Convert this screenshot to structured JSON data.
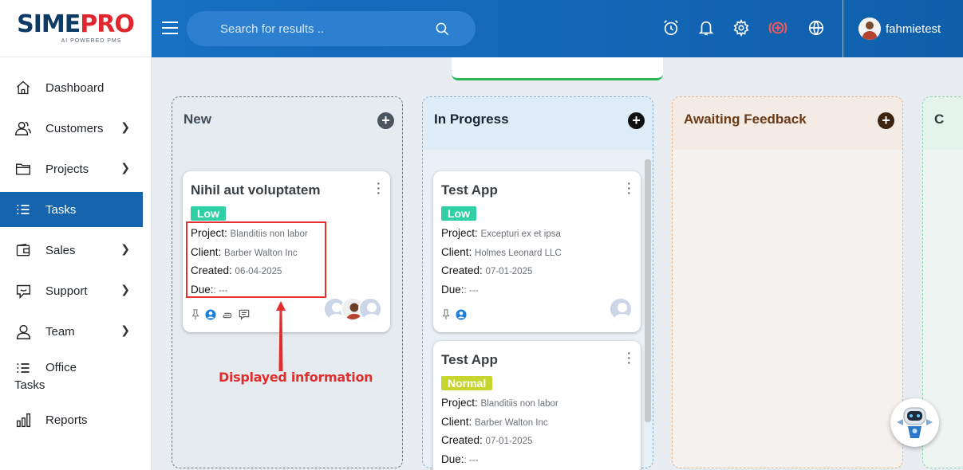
{
  "logo": {
    "brand_part1": "SIME",
    "brand_part2": "PRO",
    "tagline": "AI POWERED PMS"
  },
  "sidebar": {
    "items": [
      {
        "label": "Dashboard",
        "icon": "home-icon",
        "has_submenu": false
      },
      {
        "label": "Customers",
        "icon": "users-icon",
        "has_submenu": true
      },
      {
        "label": "Projects",
        "icon": "folder-icon",
        "has_submenu": true
      },
      {
        "label": "Tasks",
        "icon": "list-icon",
        "has_submenu": false,
        "active": true
      },
      {
        "label": "Sales",
        "icon": "wallet-icon",
        "has_submenu": true
      },
      {
        "label": "Support",
        "icon": "chat-icon",
        "has_submenu": true
      },
      {
        "label": "Team",
        "icon": "user-icon",
        "has_submenu": true
      },
      {
        "label_line1": "Office",
        "label_line2": "Tasks",
        "icon": "list-icon",
        "has_submenu": false
      },
      {
        "label": "Reports",
        "icon": "bar-chart-icon",
        "has_submenu": false
      }
    ]
  },
  "header": {
    "search_placeholder": "Search for results ..",
    "username": "fahmietest",
    "icons": [
      "alarm-clock-icon",
      "bell-icon",
      "gear-icon",
      "add-circle-icon",
      "globe-icon"
    ]
  },
  "columns": [
    {
      "title": "New",
      "accent": "#4a5561"
    },
    {
      "title": "In Progress",
      "accent": "#111111"
    },
    {
      "title": "Awaiting Feedback",
      "accent": "#3d2410"
    },
    {
      "title": "C",
      "accent": "#8dd3b0"
    }
  ],
  "cards": [
    {
      "title": "Nihil aut voluptatem",
      "priority": "Low",
      "project_label": "Project:",
      "project": "Blanditiis non labor",
      "client_label": "Client:",
      "client": "Barber Walton Inc",
      "created_label": "Created:",
      "created": "06-04-2025",
      "due_label": "Due:",
      "due": ": ---"
    },
    {
      "title": "Test App",
      "priority": "Low",
      "project_label": "Project:",
      "project": "Excepturi ex et ipsa",
      "client_label": "Client:",
      "client": "Holmes Leonard LLC",
      "created_label": "Created:",
      "created": "07-01-2025",
      "due_label": "Due:",
      "due": ": ---"
    },
    {
      "title": "Test App",
      "priority": "Normal",
      "project_label": "Project:",
      "project": "Blanditiis non labor",
      "client_label": "Client:",
      "client": "Barber Walton Inc",
      "created_label": "Created:",
      "created": "07-01-2025",
      "due_label": "Due:",
      "due": ": ---"
    }
  ],
  "annotation": {
    "callout": "Displayed information",
    "color": "#e02d2d"
  },
  "colors": {
    "primary": "#1564ad",
    "header": "#1770c2",
    "low": "#2fd0a5",
    "normal": "#c6d62e",
    "brand_red": "#e0262e"
  }
}
